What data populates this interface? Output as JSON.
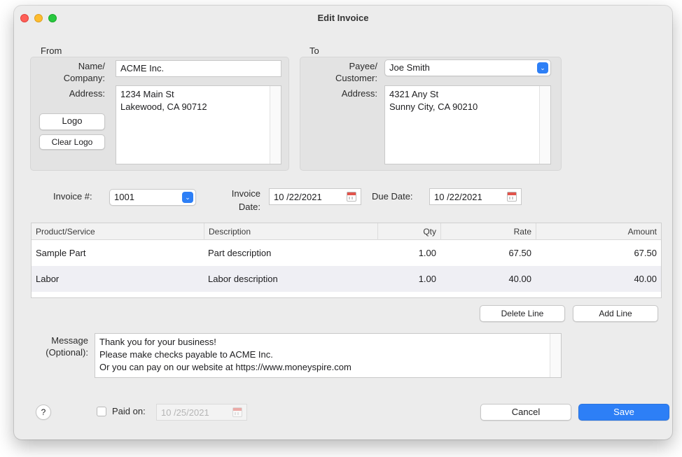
{
  "window": {
    "title": "Edit Invoice",
    "traffic_lights": [
      "close",
      "minimize",
      "zoom"
    ]
  },
  "from": {
    "section_label": "From",
    "name_label": "Name/",
    "name_label2": "Company:",
    "name_value": "ACME Inc.",
    "address_label": "Address:",
    "address_lines": [
      "1234 Main St",
      "Lakewood, CA 90712"
    ],
    "logo_button": "Logo",
    "clear_logo_button": "Clear Logo"
  },
  "to": {
    "section_label": "To",
    "payee_label": "Payee/",
    "payee_label2": "Customer:",
    "payee_value": "Joe Smith",
    "address_label": "Address:",
    "address_lines": [
      "4321 Any St",
      "Sunny City, CA 90210"
    ]
  },
  "invoice": {
    "number_label": "Invoice #:",
    "number_value": "1001",
    "date_label": "Invoice",
    "date_label2": "Date:",
    "date_value": "10 /22/2021",
    "due_label": "Due Date:",
    "due_value": "10 /22/2021"
  },
  "table": {
    "headers": [
      "Product/Service",
      "Description",
      "Qty",
      "Rate",
      "Amount"
    ],
    "rows": [
      [
        "Sample Part",
        "Part description",
        "1.00",
        "67.50",
        "67.50"
      ],
      [
        "Labor",
        "Labor description",
        "1.00",
        "40.00",
        "40.00"
      ]
    ]
  },
  "line_buttons": {
    "delete": "Delete Line",
    "add": "Add Line"
  },
  "message": {
    "label": "Message",
    "label2": "(Optional):",
    "lines": [
      "Thank you for your business!",
      "Please make checks payable to ACME Inc.",
      "Or you can pay on our website at https://www.moneyspire.com"
    ]
  },
  "footer": {
    "help": "?",
    "paid_label": "Paid on:",
    "paid_date": "10 /25/2021",
    "paid_checked": false,
    "cancel": "Cancel",
    "save": "Save"
  },
  "colors": {
    "accent": "#2d7ff6",
    "window_bg": "#ececec",
    "panel_bg": "#e3e3e3",
    "close": "#ff5f57",
    "minimize": "#febc2e",
    "zoom": "#28c840"
  }
}
